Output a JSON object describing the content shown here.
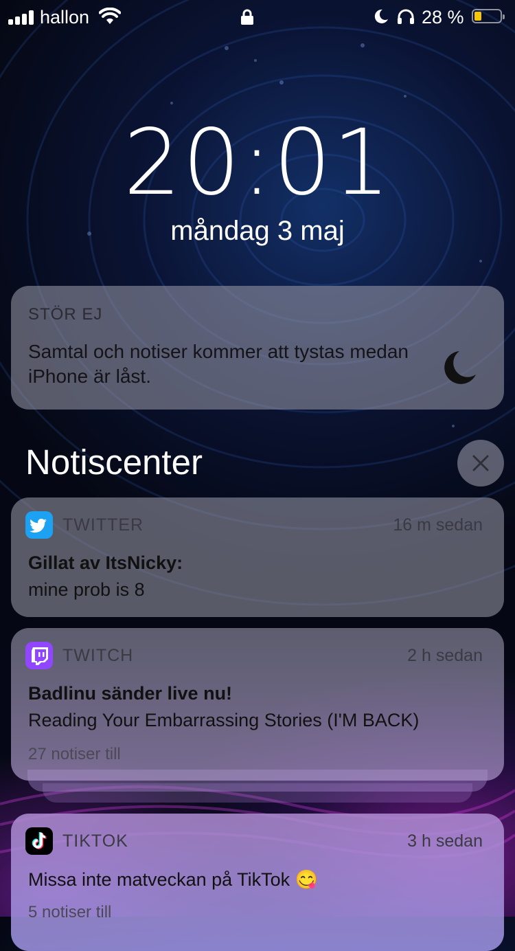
{
  "status_bar": {
    "carrier": "hallon",
    "battery_percent": "28 %",
    "battery_level": 0.28
  },
  "lock_screen": {
    "time": "20:01",
    "date": "måndag 3 maj"
  },
  "do_not_disturb": {
    "title": "STÖR EJ",
    "text": "Samtal och notiser kommer att tystas medan iPhone är låst."
  },
  "notification_center": {
    "title": "Notiscenter",
    "notifications": [
      {
        "app": "TWITTER",
        "time": "16 m sedan",
        "headline": "Gillat av ItsNicky:",
        "body": "mine prob is 8",
        "more": ""
      },
      {
        "app": "TWITCH",
        "time": "2 h sedan",
        "headline": "Badlinu sänder live nu!",
        "body": "Reading Your Embarrassing Stories (I'M BACK)",
        "more": "27 notiser till"
      },
      {
        "app": "TIKTOK",
        "time": "3 h sedan",
        "headline": "",
        "body": "Missa inte matveckan på TikTok 😋",
        "more": "5 notiser till"
      }
    ]
  },
  "colors": {
    "twitter_blue": "#1da1f2",
    "twitch_purple": "#9146ff",
    "battery_yellow": "#f6c708"
  }
}
